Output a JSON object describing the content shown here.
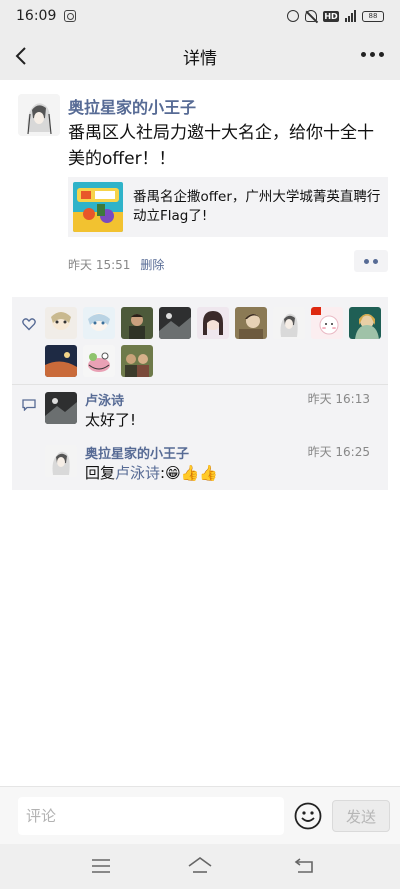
{
  "status_bar": {
    "time": "16:09",
    "battery": "88"
  },
  "nav": {
    "title": "详情"
  },
  "post": {
    "author": "奥拉星家的小王子",
    "text": "番禺区人社局力邀十大名企，给你十全十美的offer！！",
    "link": {
      "title": "番禺名企撒offer，广州大学城菁英直聘行动立Flag了!"
    },
    "time": "昨天 15:51",
    "delete_label": "删除"
  },
  "likes": {
    "avatars": [
      "avatar-1",
      "avatar-2",
      "avatar-3",
      "avatar-4",
      "avatar-5",
      "avatar-6",
      "avatar-7",
      "avatar-8",
      "avatar-9",
      "avatar-10",
      "avatar-11",
      "avatar-12"
    ]
  },
  "comments": [
    {
      "name": "卢泳诗",
      "time": "昨天 16:13",
      "text": "太好了!"
    },
    {
      "name": "奥拉星家的小王子",
      "time": "昨天 16:25",
      "reply_prefix": "回复",
      "reply_to": "卢泳诗",
      "reply_colon": ":",
      "text": "😁👍👍"
    }
  ],
  "input": {
    "placeholder": "评论",
    "send_label": "发送"
  },
  "colors": {
    "link_blue": "#576b95",
    "nav_bg": "#ededed",
    "panel_bg": "#f3f3f5"
  }
}
